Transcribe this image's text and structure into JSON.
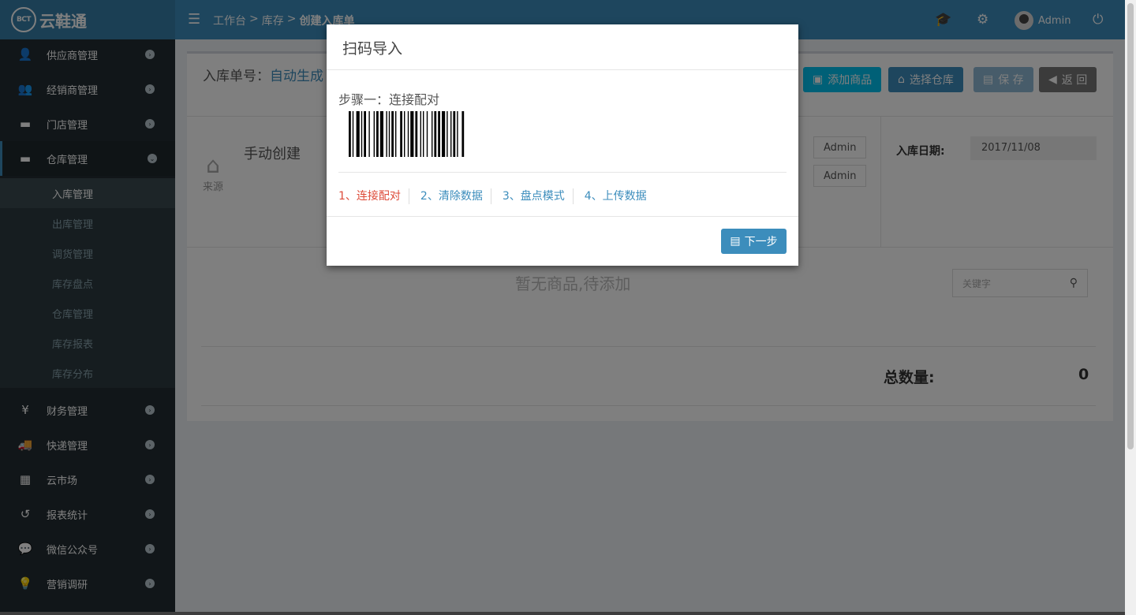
{
  "app": {
    "logo_mark": "BCT",
    "logo_text": "云鞋通"
  },
  "header": {
    "breadcrumb": [
      "工作台",
      "库存",
      "创建入库单"
    ],
    "breadcrumb_sep": ">",
    "user_name": "Admin"
  },
  "sidebar": {
    "items": [
      {
        "label": "供应商管理",
        "icon": "user-icon"
      },
      {
        "label": "经销商管理",
        "icon": "users-icon"
      },
      {
        "label": "门店管理",
        "icon": "archive-icon"
      },
      {
        "label": "仓库管理",
        "icon": "archive-icon",
        "expanded": true
      },
      {
        "label": "财务管理",
        "icon": "yen-icon"
      },
      {
        "label": "快递管理",
        "icon": "truck-icon"
      },
      {
        "label": "云市场",
        "icon": "building-icon"
      },
      {
        "label": "报表统计",
        "icon": "history-icon"
      },
      {
        "label": "微信公众号",
        "icon": "wechat-icon"
      },
      {
        "label": "营销调研",
        "icon": "lightbulb-icon"
      }
    ],
    "sub_items": [
      "入库管理",
      "出库管理",
      "调货管理",
      "库存盘点",
      "仓库管理",
      "库存报表",
      "库存分布"
    ],
    "active_sub": "入库管理"
  },
  "form": {
    "order_no_label": "入库单号：",
    "order_no_value": "自动生成",
    "buttons": {
      "add": "添加商品",
      "warehouse": "选择仓库",
      "save": "保 存",
      "back": "返 回"
    },
    "source_label": "来源",
    "manual_title": "手动创建",
    "admin_1": "Admin",
    "admin_2": "Admin",
    "date_label": "入库日期:",
    "date_value": "2017/11/08",
    "empty_msg": "暂无商品,待添加",
    "keyword_placeholder": "关键字",
    "total_label": "总数量:",
    "total_value": "0"
  },
  "modal": {
    "title": "扫码导入",
    "step_title": "步骤一：连接配对",
    "steps": [
      "1、连接配对",
      "2、清除数据",
      "3、盘点模式",
      "4、上传数据"
    ],
    "active_step": 0,
    "next_button": "下一步"
  },
  "colors": {
    "primary": "#3c8dbc",
    "active_step": "#dd4b39",
    "sidebar": "#222d32",
    "info": "#00c0ef"
  }
}
